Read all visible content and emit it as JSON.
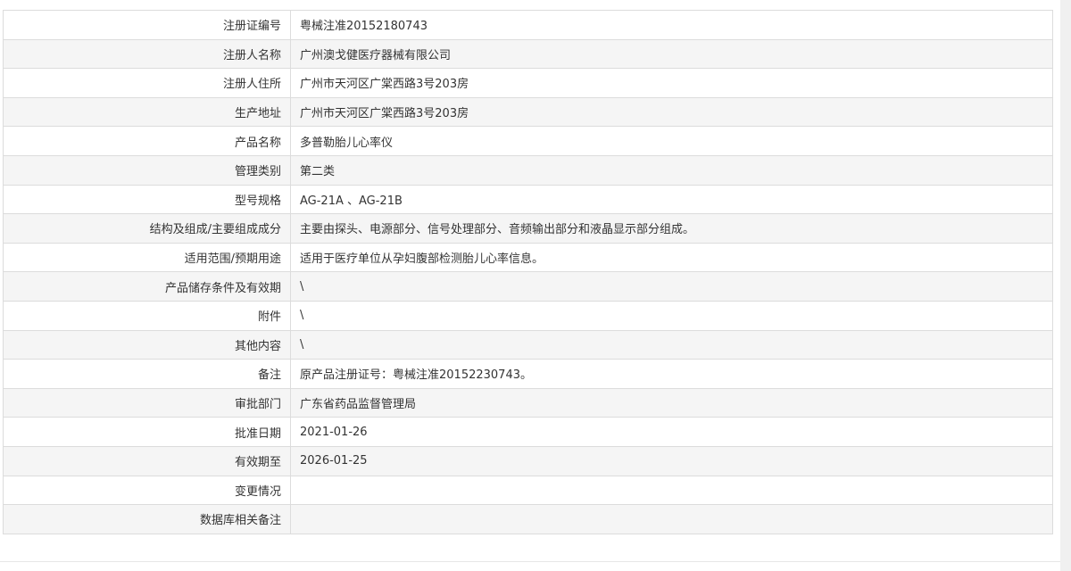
{
  "rows": [
    {
      "label": "注册证编号",
      "value": "粤械注准20152180743"
    },
    {
      "label": "注册人名称",
      "value": "广州澳戈健医疗器械有限公司"
    },
    {
      "label": "注册人住所",
      "value": "广州市天河区广棠西路3号203房"
    },
    {
      "label": "生产地址",
      "value": "广州市天河区广棠西路3号203房"
    },
    {
      "label": "产品名称",
      "value": "多普勒胎儿心率仪"
    },
    {
      "label": "管理类别",
      "value": "第二类"
    },
    {
      "label": "型号规格",
      "value": "AG-21A 、AG-21B"
    },
    {
      "label": "结构及组成/主要组成成分",
      "value": "主要由探头、电源部分、信号处理部分、音频输出部分和液晶显示部分组成。"
    },
    {
      "label": "适用范围/预期用途",
      "value": "适用于医疗单位从孕妇腹部检测胎儿心率信息。"
    },
    {
      "label": "产品储存条件及有效期",
      "value": "\\"
    },
    {
      "label": "附件",
      "value": "\\"
    },
    {
      "label": "其他内容",
      "value": "\\"
    },
    {
      "label": "备注",
      "value": "原产品注册证号：粤械注准20152230743。"
    },
    {
      "label": "审批部门",
      "value": "广东省药品监督管理局"
    },
    {
      "label": "批准日期",
      "value": "2021-01-26"
    },
    {
      "label": "有效期至",
      "value": "2026-01-25"
    },
    {
      "label": "变更情况",
      "value": ""
    },
    {
      "label": "数据库相关备注",
      "value": ""
    }
  ]
}
